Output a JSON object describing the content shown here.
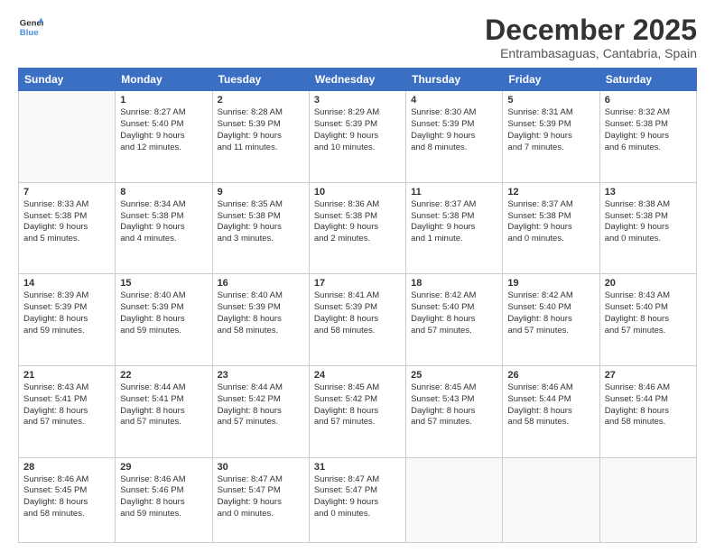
{
  "header": {
    "logo_line1": "General",
    "logo_line2": "Blue",
    "month_title": "December 2025",
    "location": "Entrambasaguas, Cantabria, Spain"
  },
  "days_of_week": [
    "Sunday",
    "Monday",
    "Tuesday",
    "Wednesday",
    "Thursday",
    "Friday",
    "Saturday"
  ],
  "weeks": [
    [
      {
        "day": "",
        "info": ""
      },
      {
        "day": "1",
        "info": "Sunrise: 8:27 AM\nSunset: 5:40 PM\nDaylight: 9 hours\nand 12 minutes."
      },
      {
        "day": "2",
        "info": "Sunrise: 8:28 AM\nSunset: 5:39 PM\nDaylight: 9 hours\nand 11 minutes."
      },
      {
        "day": "3",
        "info": "Sunrise: 8:29 AM\nSunset: 5:39 PM\nDaylight: 9 hours\nand 10 minutes."
      },
      {
        "day": "4",
        "info": "Sunrise: 8:30 AM\nSunset: 5:39 PM\nDaylight: 9 hours\nand 8 minutes."
      },
      {
        "day": "5",
        "info": "Sunrise: 8:31 AM\nSunset: 5:39 PM\nDaylight: 9 hours\nand 7 minutes."
      },
      {
        "day": "6",
        "info": "Sunrise: 8:32 AM\nSunset: 5:38 PM\nDaylight: 9 hours\nand 6 minutes."
      }
    ],
    [
      {
        "day": "7",
        "info": "Sunrise: 8:33 AM\nSunset: 5:38 PM\nDaylight: 9 hours\nand 5 minutes."
      },
      {
        "day": "8",
        "info": "Sunrise: 8:34 AM\nSunset: 5:38 PM\nDaylight: 9 hours\nand 4 minutes."
      },
      {
        "day": "9",
        "info": "Sunrise: 8:35 AM\nSunset: 5:38 PM\nDaylight: 9 hours\nand 3 minutes."
      },
      {
        "day": "10",
        "info": "Sunrise: 8:36 AM\nSunset: 5:38 PM\nDaylight: 9 hours\nand 2 minutes."
      },
      {
        "day": "11",
        "info": "Sunrise: 8:37 AM\nSunset: 5:38 PM\nDaylight: 9 hours\nand 1 minute."
      },
      {
        "day": "12",
        "info": "Sunrise: 8:37 AM\nSunset: 5:38 PM\nDaylight: 9 hours\nand 0 minutes."
      },
      {
        "day": "13",
        "info": "Sunrise: 8:38 AM\nSunset: 5:38 PM\nDaylight: 9 hours\nand 0 minutes."
      }
    ],
    [
      {
        "day": "14",
        "info": "Sunrise: 8:39 AM\nSunset: 5:39 PM\nDaylight: 8 hours\nand 59 minutes."
      },
      {
        "day": "15",
        "info": "Sunrise: 8:40 AM\nSunset: 5:39 PM\nDaylight: 8 hours\nand 59 minutes."
      },
      {
        "day": "16",
        "info": "Sunrise: 8:40 AM\nSunset: 5:39 PM\nDaylight: 8 hours\nand 58 minutes."
      },
      {
        "day": "17",
        "info": "Sunrise: 8:41 AM\nSunset: 5:39 PM\nDaylight: 8 hours\nand 58 minutes."
      },
      {
        "day": "18",
        "info": "Sunrise: 8:42 AM\nSunset: 5:40 PM\nDaylight: 8 hours\nand 57 minutes."
      },
      {
        "day": "19",
        "info": "Sunrise: 8:42 AM\nSunset: 5:40 PM\nDaylight: 8 hours\nand 57 minutes."
      },
      {
        "day": "20",
        "info": "Sunrise: 8:43 AM\nSunset: 5:40 PM\nDaylight: 8 hours\nand 57 minutes."
      }
    ],
    [
      {
        "day": "21",
        "info": "Sunrise: 8:43 AM\nSunset: 5:41 PM\nDaylight: 8 hours\nand 57 minutes."
      },
      {
        "day": "22",
        "info": "Sunrise: 8:44 AM\nSunset: 5:41 PM\nDaylight: 8 hours\nand 57 minutes."
      },
      {
        "day": "23",
        "info": "Sunrise: 8:44 AM\nSunset: 5:42 PM\nDaylight: 8 hours\nand 57 minutes."
      },
      {
        "day": "24",
        "info": "Sunrise: 8:45 AM\nSunset: 5:42 PM\nDaylight: 8 hours\nand 57 minutes."
      },
      {
        "day": "25",
        "info": "Sunrise: 8:45 AM\nSunset: 5:43 PM\nDaylight: 8 hours\nand 57 minutes."
      },
      {
        "day": "26",
        "info": "Sunrise: 8:46 AM\nSunset: 5:44 PM\nDaylight: 8 hours\nand 58 minutes."
      },
      {
        "day": "27",
        "info": "Sunrise: 8:46 AM\nSunset: 5:44 PM\nDaylight: 8 hours\nand 58 minutes."
      }
    ],
    [
      {
        "day": "28",
        "info": "Sunrise: 8:46 AM\nSunset: 5:45 PM\nDaylight: 8 hours\nand 58 minutes."
      },
      {
        "day": "29",
        "info": "Sunrise: 8:46 AM\nSunset: 5:46 PM\nDaylight: 8 hours\nand 59 minutes."
      },
      {
        "day": "30",
        "info": "Sunrise: 8:47 AM\nSunset: 5:47 PM\nDaylight: 9 hours\nand 0 minutes."
      },
      {
        "day": "31",
        "info": "Sunrise: 8:47 AM\nSunset: 5:47 PM\nDaylight: 9 hours\nand 0 minutes."
      },
      {
        "day": "",
        "info": ""
      },
      {
        "day": "",
        "info": ""
      },
      {
        "day": "",
        "info": ""
      }
    ]
  ]
}
